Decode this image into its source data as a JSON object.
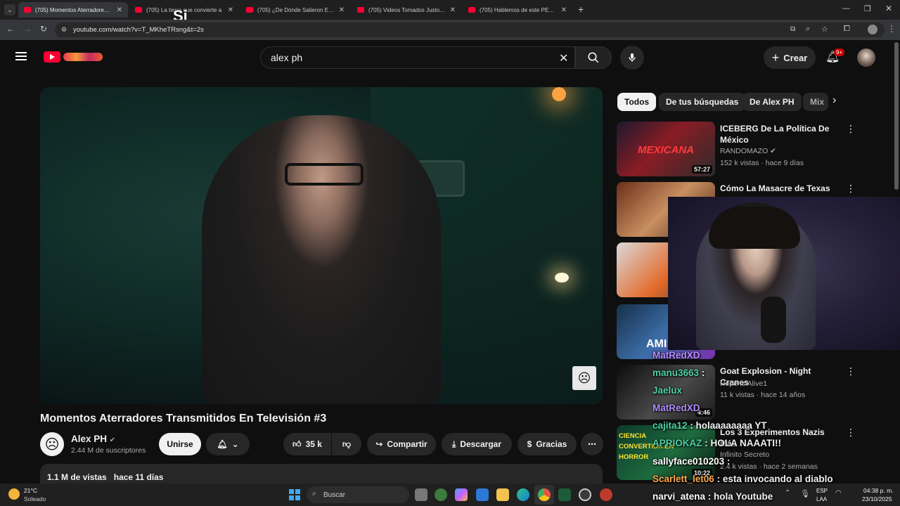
{
  "browser": {
    "tabs": [
      {
        "label": "(705) Momentos Aterradores Tr"
      },
      {
        "label": "(705) La tierra que convierte a"
      },
      {
        "label": "(705) ¿De Dónde Salieron Estas"
      },
      {
        "label": "(705) Videos Tomados Justo Ar"
      },
      {
        "label": "(705) Hablemos de este PELICU"
      }
    ],
    "new_tab": "+",
    "overlay_text": "Si",
    "url": "youtube.com/watch?v=T_MKheTRsng&t=2s"
  },
  "header": {
    "search_value": "alex ph",
    "create_label": "Crear",
    "notif_badge": "9+"
  },
  "video": {
    "title": "Momentos Aterradores Transmitidos En Televisión #3",
    "channel": "Alex PH",
    "subs": "2.44 M de suscriptores",
    "join_label": "Unirse",
    "likes": "35 k",
    "share_label": "Compartir",
    "download_label": "Descargar",
    "thanks_label": "Gracias",
    "views": "1.1 M de vistas",
    "age": "hace 11 días"
  },
  "chips": [
    "Todos",
    "De tus búsquedas",
    "De Alex PH",
    "Mix"
  ],
  "related": [
    {
      "title": "ICEBERG De La Política De México",
      "channel": "RANDOMAZO",
      "meta": "152 k vistas · hace 9 días",
      "duration": "57:27",
      "thumb_text": "MEXICANA"
    },
    {
      "title": "Cómo La Masacre de Texas",
      "channel": "",
      "meta": "",
      "duration": "",
      "thumb_text": ""
    },
    {
      "title": "",
      "channel": "",
      "meta": "",
      "duration": "",
      "thumb_text": ""
    },
    {
      "title": "",
      "channel": "",
      "meta": "",
      "duration": "",
      "thumb_text": "AMI"
    },
    {
      "title": "Goat Explosion - Night Cranes",
      "channel": "Hope Is Alive1",
      "meta": "11 k vistas · hace 14 años",
      "duration": "4:46",
      "thumb_text": ""
    },
    {
      "title": "Los 3 Experimentos Nazis Más",
      "channel": "Infinito Secreto",
      "meta": "2.4 k vistas · hace 2 semanas",
      "duration": "10:22",
      "thumb_text": "CIENCIA CONVERTIDA EN HORROR"
    }
  ],
  "chat": [
    {
      "user": "MatRedXD",
      "msg": "",
      "color": "#b48cff"
    },
    {
      "user": "manu3663",
      "msg": ":",
      "color": "#4fd1a5"
    },
    {
      "user": "Jaelux",
      "msg": "",
      "color": "#4fd1a5"
    },
    {
      "user": "MatRedXD",
      "msg": "",
      "color": "#b48cff"
    },
    {
      "user": "cajita12",
      "msg": ": holaaaaaaaa YT",
      "color": "#4fd1a5"
    },
    {
      "user": "APRIOKAZ",
      "msg": ": HOLA NAAATI!!",
      "color": "#4fd1a5"
    },
    {
      "user": "sallyface010203",
      "msg": ":",
      "color": "#ffffff"
    },
    {
      "user": "Scarlett_let06",
      "msg": ": esta invocando al diablo",
      "color": "#ffa64d"
    },
    {
      "user": "narvi_atena",
      "msg": ": hola Youtube",
      "color": "#ffffff"
    }
  ],
  "taskbar": {
    "temp": "21°C",
    "weather": "Soleado",
    "search_placeholder": "Buscar",
    "lang1": "ESP",
    "lang2": "LAA",
    "time": "04:38 p. m.",
    "date": "23/10/2025"
  },
  "colors": {
    "yt_red": "#ff0033",
    "bg": "#0f0f0f",
    "surface": "#272727"
  }
}
